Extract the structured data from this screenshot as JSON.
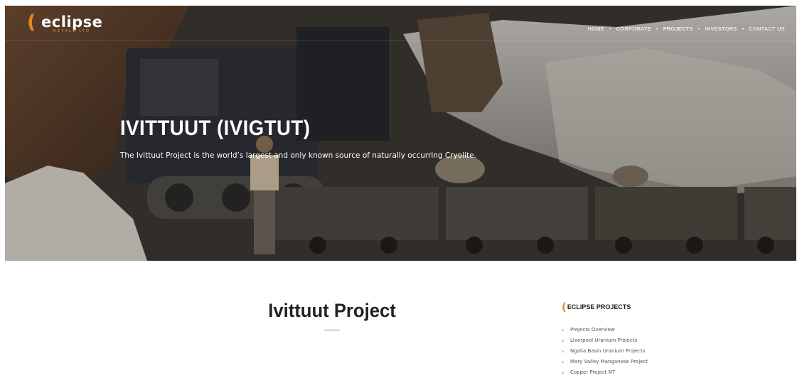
{
  "brand": {
    "logo_c": "(",
    "logo_word": "eclipse",
    "logo_sub": "METALS LTD"
  },
  "nav": {
    "items": [
      {
        "label": "HOME"
      },
      {
        "label": "CORPORATE"
      },
      {
        "label": "PROJECTS"
      },
      {
        "label": "INVESTORS"
      },
      {
        "label": "CONTACT US"
      }
    ],
    "separator": "•",
    "active": "PROJECTS"
  },
  "hero": {
    "title": "IVITTUUT (IVIGTUT)",
    "subtitle": "The Ivittuut Project is the world’s largest and only known source of naturally occurring Cryolite."
  },
  "main": {
    "title": "Ivittuut Project"
  },
  "sidebar": {
    "heading": "ECLIPSE PROJECTS",
    "items": [
      {
        "label": "Projects Overview"
      },
      {
        "label": "Liverpool Uranium Projects"
      },
      {
        "label": "Ngalia Basin Uranium Projects"
      },
      {
        "label": "Mary Valley Manganese Project"
      },
      {
        "label": "Copper Project NT"
      }
    ],
    "chevron": "›"
  },
  "colors": {
    "accent": "#e08a1e",
    "text_dark": "#222222"
  }
}
